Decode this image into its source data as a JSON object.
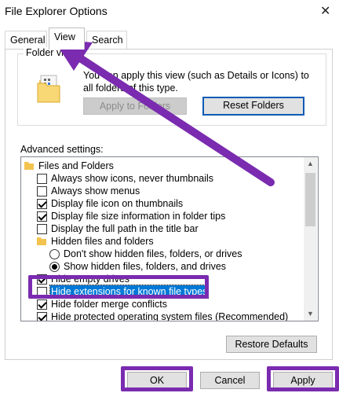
{
  "window": {
    "title": "File Explorer Options",
    "close_glyph": "✕"
  },
  "tabs": [
    {
      "label": "General",
      "active": false
    },
    {
      "label": "View",
      "active": true
    },
    {
      "label": "Search",
      "active": false
    }
  ],
  "folder_views": {
    "label": "Folder views",
    "description": "You can apply this view (such as Details or Icons) to all folders of this type.",
    "apply_label": "Apply to Folders",
    "reset_label": "Reset Folders"
  },
  "advanced": {
    "label": "Advanced settings:",
    "items": [
      {
        "type": "folder",
        "label": "Files and Folders",
        "indent": 0
      },
      {
        "type": "checkbox",
        "label": "Always show icons, never thumbnails",
        "checked": false,
        "indent": 1
      },
      {
        "type": "checkbox",
        "label": "Always show menus",
        "checked": false,
        "indent": 1
      },
      {
        "type": "checkbox",
        "label": "Display file icon on thumbnails",
        "checked": true,
        "indent": 1
      },
      {
        "type": "checkbox",
        "label": "Display file size information in folder tips",
        "checked": true,
        "indent": 1
      },
      {
        "type": "checkbox",
        "label": "Display the full path in the title bar",
        "checked": false,
        "indent": 1
      },
      {
        "type": "folder",
        "label": "Hidden files and folders",
        "indent": 1
      },
      {
        "type": "radio",
        "label": "Don't show hidden files, folders, or drives",
        "checked": false,
        "indent": 2
      },
      {
        "type": "radio",
        "label": "Show hidden files, folders, and drives",
        "checked": true,
        "indent": 2
      },
      {
        "type": "checkbox",
        "label": "Hide empty drives",
        "checked": true,
        "indent": 1
      },
      {
        "type": "checkbox",
        "label": "Hide extensions for known file types",
        "checked": false,
        "indent": 1,
        "selected": true
      },
      {
        "type": "checkbox",
        "label": "Hide folder merge conflicts",
        "checked": true,
        "indent": 1
      },
      {
        "type": "checkbox",
        "label": "Hide protected operating system files (Recommended)",
        "checked": true,
        "indent": 1
      }
    ]
  },
  "buttons": {
    "restore": "Restore Defaults",
    "ok": "OK",
    "cancel": "Cancel",
    "apply": "Apply"
  },
  "colors": {
    "highlight": "#7a2bb0",
    "selection": "#0078d7"
  }
}
